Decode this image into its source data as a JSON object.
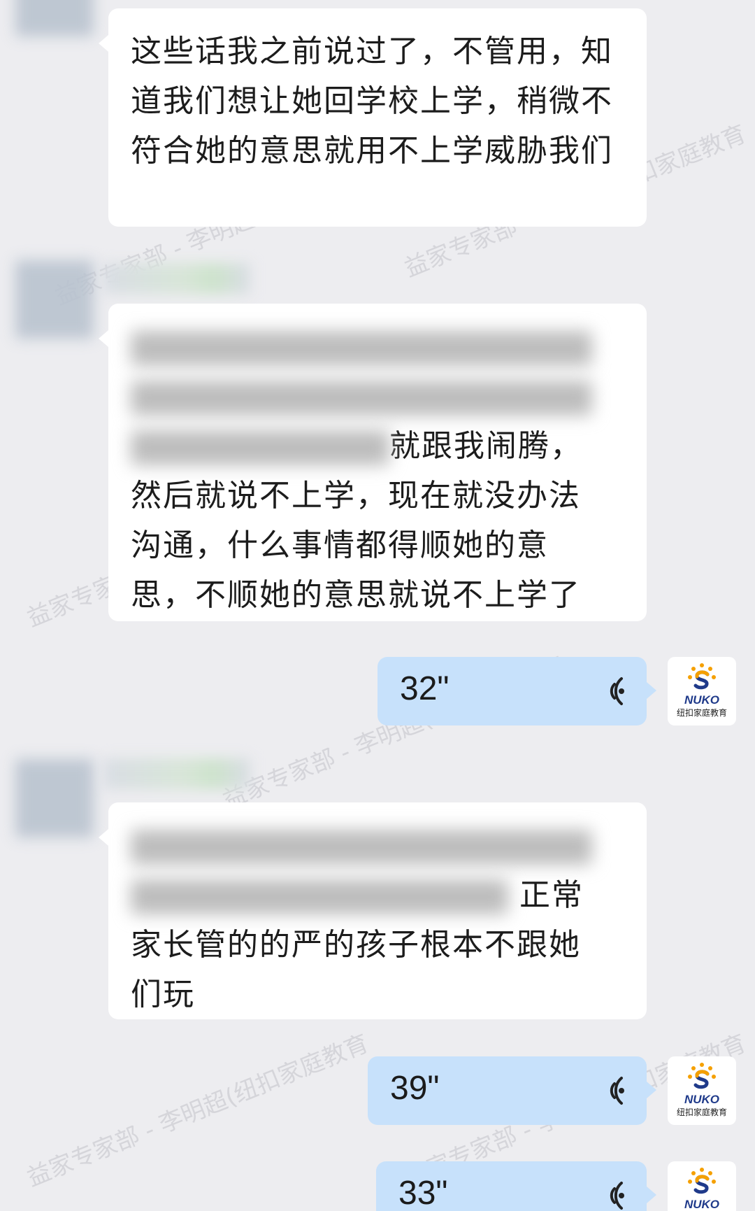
{
  "watermark": "益家专家部 - 李明超(纽扣家庭教育",
  "messages": [
    {
      "text": "这些话我之前说过了，不管用，知道我们想让她回学校上学，稍微不符合她的意思就用不上学威胁我们"
    },
    {
      "visible_tail_line3": "就跟我闹腾，",
      "lines": [
        "然后就说不上学，现在就没办法",
        "沟通，什么事情都得顺她的意",
        "思，不顺她的意思就说不上学了"
      ]
    },
    {
      "visible_tail_line2": "正常",
      "lines": [
        "家长管的的严的孩子根本不跟她",
        "们玩"
      ]
    }
  ],
  "voice_messages": [
    {
      "duration": "32\""
    },
    {
      "duration": "39\""
    },
    {
      "duration": "33\""
    }
  ],
  "sender_avatar": {
    "logo_word": "NUKO",
    "logo_subtitle": "纽扣家庭教育",
    "icon": "sun-s-logo"
  },
  "colors": {
    "background": "#ededf0",
    "incoming_bubble": "#ffffff",
    "voice_bubble": "#c7e1fb",
    "logo_orange": "#f5a000",
    "logo_blue": "#1f3a8a"
  }
}
